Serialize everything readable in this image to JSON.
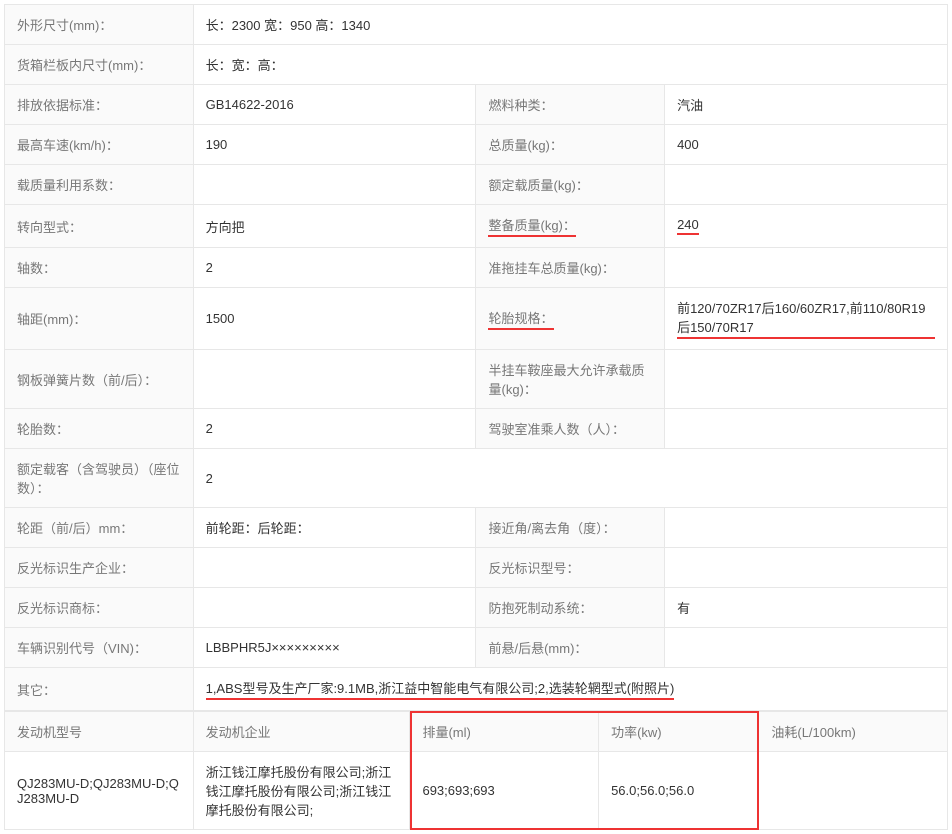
{
  "rows": {
    "dim_label": "外形尺寸(mm)：",
    "dim_value": "长：2300 宽：950 高：1340",
    "cargo_label": "货箱栏板内尺寸(mm)：",
    "cargo_value": "长：宽：高：",
    "emission_label": "排放依据标准：",
    "emission_value": "GB14622-2016",
    "fuel_label": "燃料种类：",
    "fuel_value": "汽油",
    "topspeed_label": "最高车速(km/h)：",
    "topspeed_value": "190",
    "gross_label": "总质量(kg)：",
    "gross_value": "400",
    "loadratio_label": "载质量利用系数：",
    "loadratio_value": "",
    "rated_label": "额定载质量(kg)：",
    "rated_value": "",
    "steer_label": "转向型式：",
    "steer_value": "方向把",
    "curb_label": "整备质量(kg)：",
    "curb_value": "240",
    "axles_label": "轴数：",
    "axles_value": "2",
    "trailer_label": "准拖挂车总质量(kg)：",
    "trailer_value": "",
    "wheelbase_label": "轴距(mm)：",
    "wheelbase_value": "1500",
    "tire_label": "轮胎规格：",
    "tire_value": "前120/70ZR17后160/60ZR17,前110/80R19后150/70R17",
    "spring_label": "钢板弹簧片数（前/后）：",
    "spring_value": "",
    "saddle_label": "半挂车鞍座最大允许承载质量(kg)：",
    "saddle_value": "",
    "tirecount_label": "轮胎数：",
    "tirecount_value": "2",
    "cabseats_label": "驾驶室准乘人数（人）：",
    "cabseats_value": "",
    "pax_label": "额定载客（含驾驶员）（座位数）：",
    "pax_value": "2",
    "track_label": "轮距（前/后）mm：",
    "track_value": "前轮距：后轮距：",
    "approach_label": "接近角/离去角（度）：",
    "approach_value": "",
    "reflmaker_label": "反光标识生产企业：",
    "reflmaker_value": "",
    "reflmodel_label": "反光标识型号：",
    "reflmodel_value": "",
    "refltm_label": "反光标识商标：",
    "refltm_value": "",
    "abs_label": "防抱死制动系统：",
    "abs_value": "有",
    "vin_label": "车辆识别代号（VIN)：",
    "vin_value": "LBBPHR5J×××××××××",
    "overhang_label": "前悬/后悬(mm)：",
    "overhang_value": "",
    "other_label": "其它：",
    "other_value": "1,ABS型号及生产厂家:9.1MB,浙江益中智能电气有限公司;2,选装轮辋型式(附照片)"
  },
  "engine": {
    "h_model": "发动机型号",
    "h_maker": "发动机企业",
    "h_disp": "排量(ml)",
    "h_power": "功率(kw)",
    "h_fuel": "油耗(L/100km)",
    "model": "QJ283MU-D;QJ283MU-D;QJ283MU-D",
    "maker": "浙江钱江摩托股份有限公司;浙江钱江摩托股份有限公司;浙江钱江摩托股份有限公司;",
    "disp": "693;693;693",
    "power": "56.0;56.0;56.0",
    "fuel": ""
  }
}
